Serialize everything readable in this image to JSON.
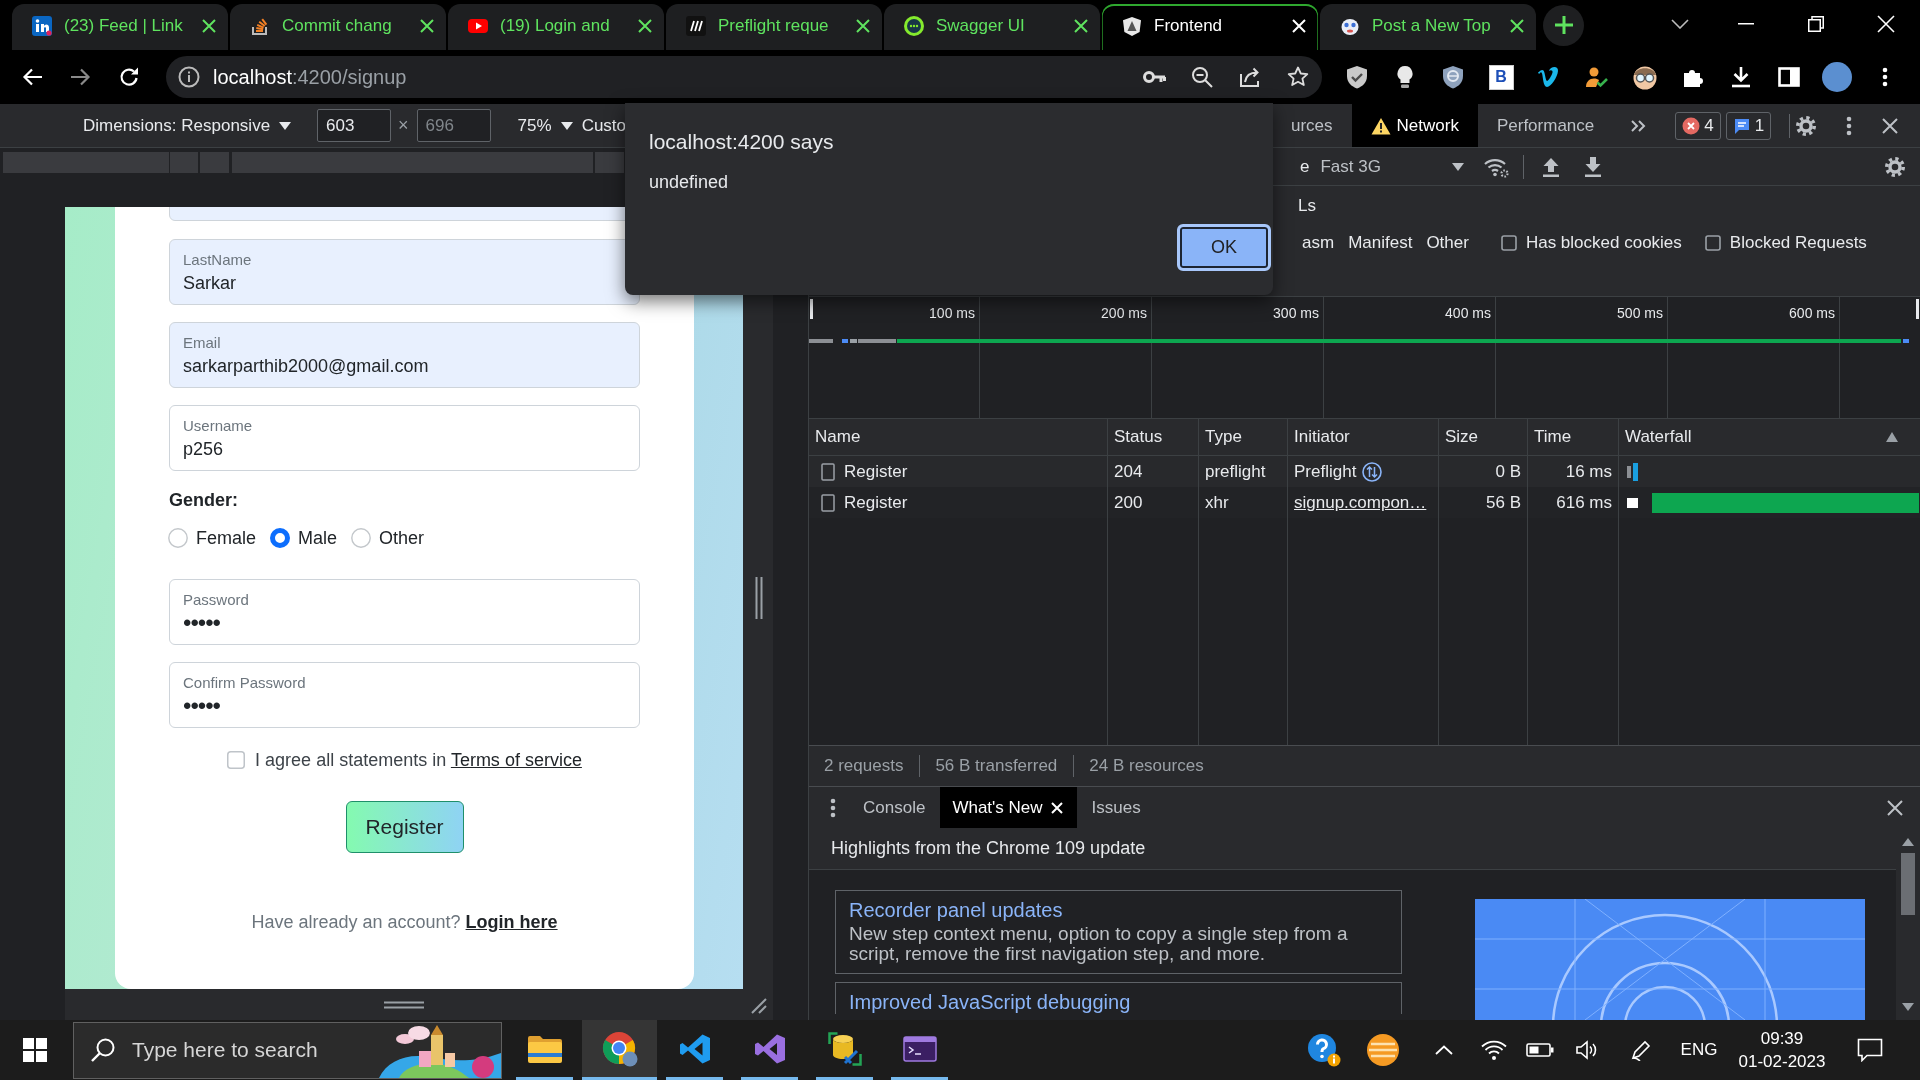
{
  "browser": {
    "tabs": [
      {
        "title": "(23) Feed | Link",
        "selected": false
      },
      {
        "title": "Commit chang",
        "selected": false
      },
      {
        "title": "(19) Login and",
        "selected": false
      },
      {
        "title": "Preflight reque",
        "selected": false
      },
      {
        "title": "Swagger UI",
        "selected": false
      },
      {
        "title": "Frontend",
        "selected": true
      },
      {
        "title": "Post a New Top",
        "selected": false
      }
    ],
    "address": {
      "host": "localhost",
      "path": ":4200/signup"
    },
    "extension_label": "B"
  },
  "device_toolbar": {
    "dimensions": "Dimensions: Responsive",
    "width": {
      "value": "603"
    },
    "times": "×",
    "height": {
      "placeholder": "696"
    },
    "zoom": "75%",
    "throttling": "Custo"
  },
  "page": {
    "fields": [
      {
        "autofilled": true
      },
      {
        "label": "LastName",
        "value": "Sarkar",
        "autofilled": true
      },
      {
        "label": "Email",
        "value": "sarkarparthib2000@gmail.com",
        "autofilled": true
      },
      {
        "label": "Username",
        "value": "p256",
        "autofilled": false
      }
    ],
    "gender": {
      "label": "Gender:",
      "options": [
        {
          "label": "Female",
          "selected": false
        },
        {
          "label": "Male",
          "selected": true
        },
        {
          "label": "Other",
          "selected": false
        }
      ]
    },
    "password_fields": [
      {
        "label": "Password",
        "value": "•••••"
      },
      {
        "label": "Confirm Password",
        "value": "•••••"
      }
    ],
    "agree": {
      "text": "I agree all statements in ",
      "link": "Terms of service",
      "checked": false
    },
    "register_button": "Register",
    "footer": {
      "text": "Have already an account? ",
      "link": "Login here"
    }
  },
  "dialog": {
    "title": "localhost:4200 says",
    "message": "undefined",
    "button": "OK"
  },
  "devtools": {
    "tabs": [
      {
        "label": "urces",
        "selected": false,
        "warning": false
      },
      {
        "label": "Network",
        "selected": true,
        "warning": true
      },
      {
        "label": "Performance",
        "selected": false,
        "warning": false
      }
    ],
    "error_count": "4",
    "message_count": "1",
    "network_toolbar": {
      "label": "e",
      "throttling": "Fast 3G"
    },
    "filters": {
      "label": "Ls",
      "types": [
        "asm",
        "Manifest",
        "Other"
      ],
      "checkboxes": [
        {
          "label": "Has blocked cookies",
          "checked": false
        },
        {
          "label": "Blocked Requests",
          "checked": false
        }
      ]
    },
    "overview": {
      "ticks": [
        "100 ms",
        "200 ms",
        "300 ms",
        "400 ms",
        "500 ms",
        "600 ms"
      ]
    },
    "table": {
      "columns": [
        "Name",
        "Status",
        "Type",
        "Initiator",
        "Size",
        "Time",
        "Waterfall"
      ],
      "rows": [
        {
          "name": "Register",
          "status": "204",
          "type": "preflight",
          "initiator": {
            "text": "Preflight",
            "kind": "preflight"
          },
          "size": "0 B",
          "time": "16 ms"
        },
        {
          "name": "Register",
          "status": "200",
          "type": "xhr",
          "initiator": {
            "text": "signup.compon…",
            "kind": "link"
          },
          "size": "56 B",
          "time": "616 ms"
        }
      ]
    },
    "summary": [
      "2 requests",
      "56 B transferred",
      "24 B resources"
    ],
    "drawer": {
      "tabs": [
        {
          "label": "Console",
          "selected": false
        },
        {
          "label": "What's New",
          "selected": true
        },
        {
          "label": "Issues",
          "selected": false
        }
      ],
      "heading": "Highlights from the Chrome 109 update",
      "cards": [
        {
          "title": "Recorder panel updates",
          "body": "New step context menu, option to copy a single step from a script, remove the first navigation step, and more."
        },
        {
          "title": "Improved JavaScript debugging"
        }
      ]
    }
  },
  "taskbar": {
    "search": {
      "placeholder": "Type here to search"
    },
    "apps": [
      {
        "running": true,
        "selected": false
      },
      {
        "running": true,
        "selected": true
      },
      {
        "running": true,
        "selected": false
      },
      {
        "running": true,
        "selected": false
      },
      {
        "running": true,
        "selected": false
      },
      {
        "running": true,
        "selected": false
      }
    ],
    "language": "ENG",
    "time": "09:39",
    "date": "01-02-2023"
  }
}
